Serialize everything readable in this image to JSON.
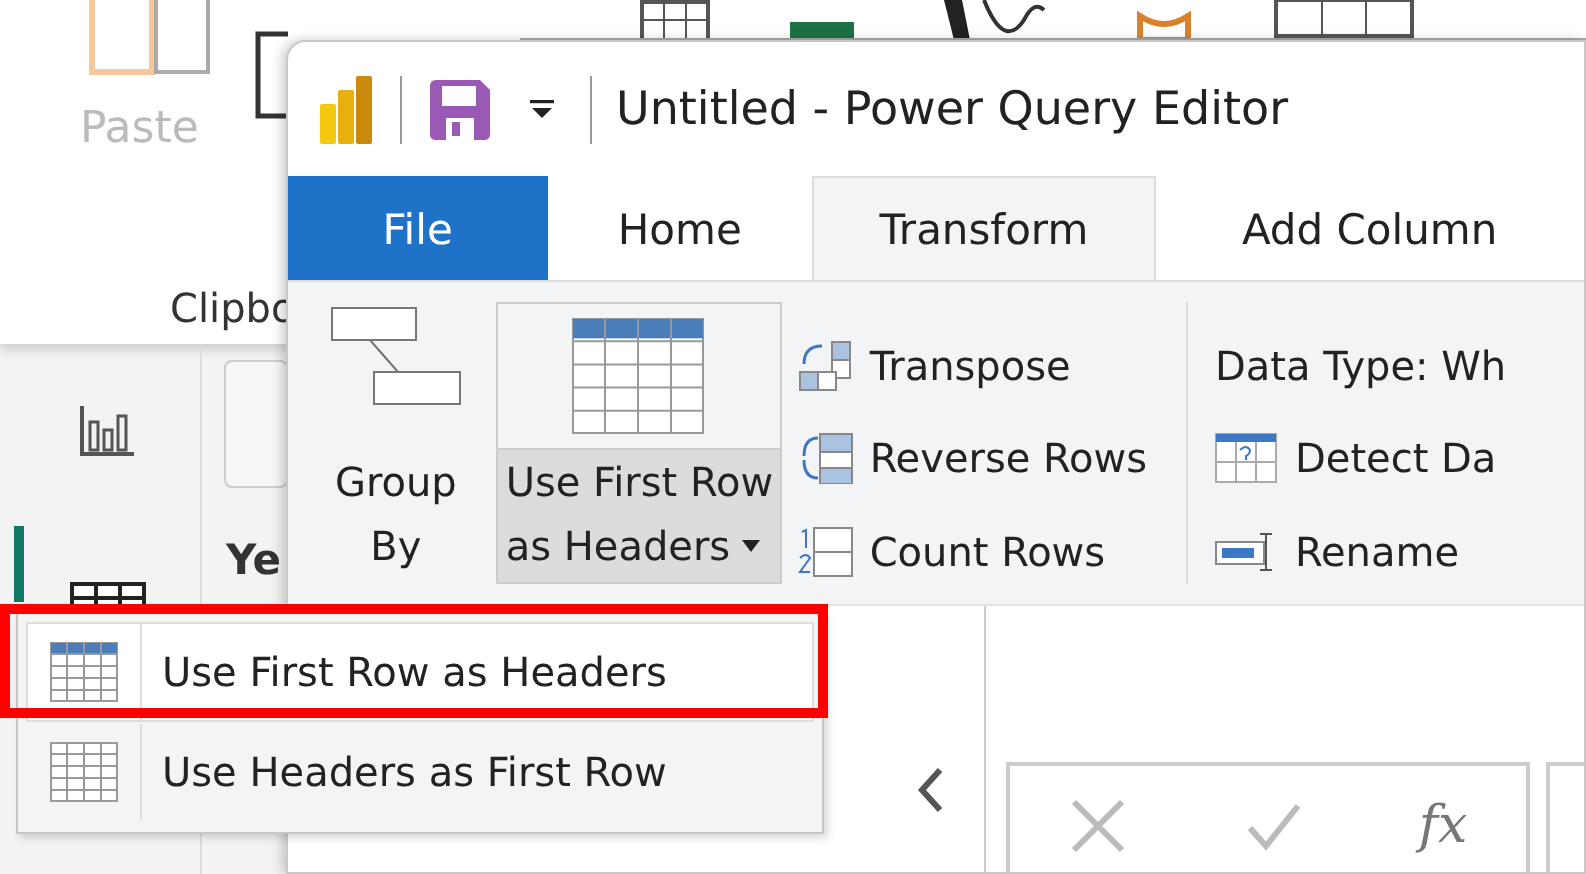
{
  "background_app": {
    "ribbon": {
      "paste_label": "Paste",
      "group_label": "Clipbo"
    },
    "column_header": "Ye"
  },
  "window": {
    "title": "Untitled - Power Query Editor"
  },
  "tabs": [
    {
      "label": "File",
      "kind": "file",
      "selected": false
    },
    {
      "label": "Home",
      "kind": "tab",
      "selected": false
    },
    {
      "label": "Transform",
      "kind": "tab",
      "selected": true
    },
    {
      "label": "Add Column",
      "kind": "tab",
      "selected": false
    }
  ],
  "ribbon": {
    "large_buttons": [
      {
        "kind": "group",
        "lines": [
          "Group",
          "By"
        ],
        "pressed": false
      },
      {
        "kind": "headers",
        "lines": [
          "Use First Row",
          "as Headers"
        ],
        "pressed": true
      }
    ],
    "table_buttons": [
      {
        "kind": "transpose",
        "label": "Transpose"
      },
      {
        "kind": "reverse",
        "label": "Reverse Rows"
      },
      {
        "kind": "count",
        "label": "Count Rows"
      }
    ],
    "any_column": [
      {
        "kind": "datatype",
        "label": "Data Type: Wh"
      },
      {
        "kind": "detect",
        "label": "Detect Da"
      },
      {
        "kind": "rename",
        "label": "Rename"
      }
    ]
  },
  "formula_bar": {
    "fx": "fx"
  },
  "menu": {
    "items": [
      {
        "label": "Use First Row as Headers",
        "selected": true,
        "annotated": true
      },
      {
        "label": "Use Headers as First Row",
        "selected": false,
        "annotated": false
      }
    ]
  }
}
